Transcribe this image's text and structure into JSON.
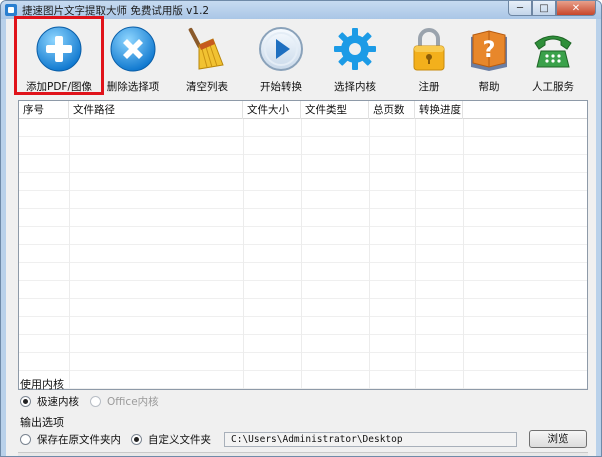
{
  "window": {
    "title": "捷速图片文字提取大师 免费试用版 v1.2",
    "minimize_label": "─",
    "maximize_label": "□",
    "close_label": "✕"
  },
  "toolbar": {
    "items": [
      {
        "label": "添加PDF/图像",
        "icon": "add-circle-icon"
      },
      {
        "label": "删除选择项",
        "icon": "delete-circle-icon"
      },
      {
        "label": "清空列表",
        "icon": "broom-icon"
      },
      {
        "label": "开始转换",
        "icon": "play-icon"
      },
      {
        "label": "选择内核",
        "icon": "gear-icon"
      },
      {
        "label": "注册",
        "icon": "lock-icon"
      },
      {
        "label": "帮助",
        "icon": "help-book-icon"
      },
      {
        "label": "人工服务",
        "icon": "phone-icon"
      }
    ]
  },
  "file_table": {
    "columns": [
      "序号",
      "文件路径",
      "文件大小",
      "文件类型",
      "总页数",
      "转换进度"
    ],
    "rows": []
  },
  "engine": {
    "title": "使用内核",
    "options": [
      {
        "label": "极速内核",
        "selected": true,
        "enabled": true
      },
      {
        "label": "Office内核",
        "selected": false,
        "enabled": false
      }
    ]
  },
  "output": {
    "title": "输出选项",
    "options": [
      {
        "label": "保存在原文件夹内",
        "selected": false
      },
      {
        "label": "自定义文件夹",
        "selected": true
      }
    ],
    "path": "C:\\Users\\Administrator\\Desktop",
    "browse_label": "浏览"
  },
  "colors": {
    "highlight": "#e0131a",
    "accent_blue": "#1d8fe0",
    "title_bar": "#b9d1ea"
  }
}
